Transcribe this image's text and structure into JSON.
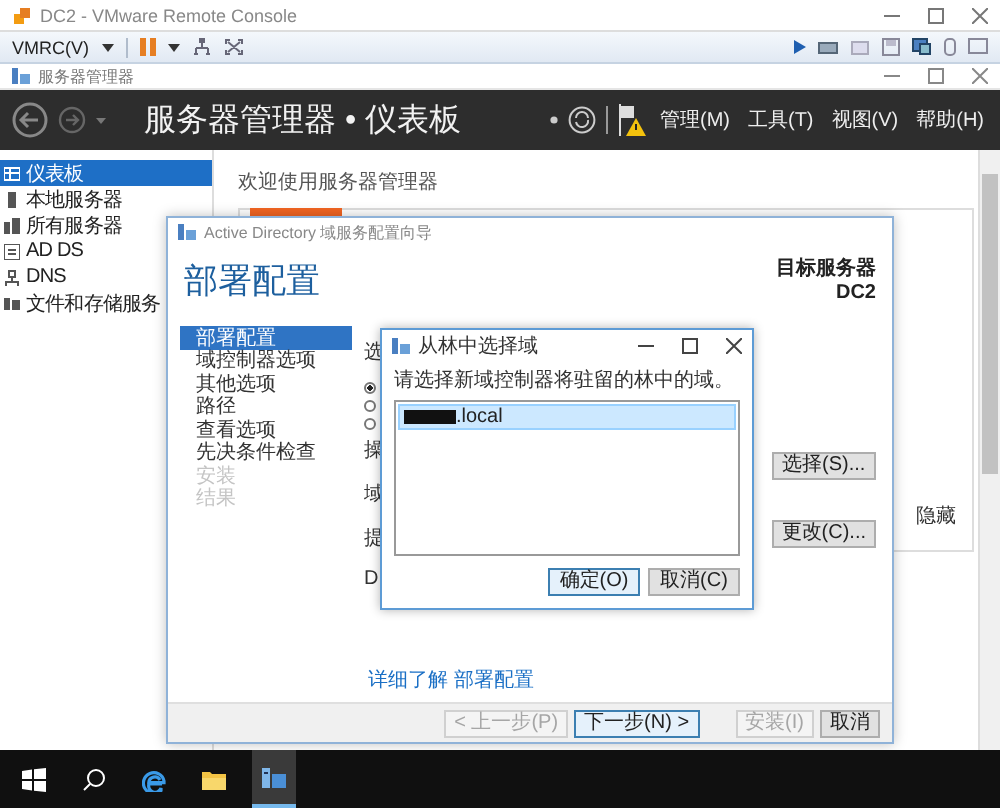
{
  "vmrc": {
    "title": "DC2 - VMware Remote Console",
    "menu": "VMRC(V)"
  },
  "app_window": {
    "title": "服务器管理器"
  },
  "header": {
    "title": "服务器管理器 • 仪表板",
    "menus": [
      "管理(M)",
      "工具(T)",
      "视图(V)",
      "帮助(H)"
    ]
  },
  "sidebar": {
    "items": [
      {
        "label": "仪表板",
        "kind": "dashboard",
        "selected": true
      },
      {
        "label": "本地服务器",
        "kind": "server",
        "selected": false
      },
      {
        "label": "所有服务器",
        "kind": "servers",
        "selected": false
      },
      {
        "label": "AD DS",
        "kind": "directory",
        "selected": false
      },
      {
        "label": "DNS",
        "kind": "network",
        "selected": false
      },
      {
        "label": "文件和存储服务",
        "kind": "storage",
        "selected": false
      }
    ]
  },
  "welcome": {
    "title": "欢迎使用服务器管理器",
    "hide_link": "隐藏"
  },
  "wizard": {
    "title": "Active Directory 域服务配置向导",
    "heading": "部署配置",
    "target_label": "目标服务器",
    "target_server": "DC2",
    "steps": [
      {
        "label": "部署配置",
        "selected": true,
        "disabled": false
      },
      {
        "label": "域控制器选项",
        "selected": false,
        "disabled": false
      },
      {
        "label": "其他选项",
        "selected": false,
        "disabled": false
      },
      {
        "label": "路径",
        "selected": false,
        "disabled": false
      },
      {
        "label": "查看选项",
        "selected": false,
        "disabled": false
      },
      {
        "label": "先决条件检查",
        "selected": false,
        "disabled": false
      },
      {
        "label": "安装",
        "selected": false,
        "disabled": true
      },
      {
        "label": "结果",
        "selected": false,
        "disabled": true
      }
    ],
    "fragments": [
      {
        "kind": "text",
        "text": "选"
      },
      {
        "kind": "radio",
        "selected": true
      },
      {
        "kind": "radio",
        "selected": false
      },
      {
        "kind": "radio",
        "selected": false
      },
      {
        "kind": "text",
        "text": "操"
      },
      {
        "kind": "text",
        "text": "域"
      },
      {
        "kind": "text",
        "text": "提"
      },
      {
        "kind": "text",
        "text": "D"
      }
    ],
    "select_button": "选择(S)...",
    "change_button": "更改(C)...",
    "help_link": "详细了解 部署配置",
    "buttons": [
      {
        "label": "< 上一步(P)",
        "disabled": true,
        "default": false
      },
      {
        "label": "下一步(N) >",
        "disabled": false,
        "default": true
      },
      {
        "label": "安装(I)",
        "disabled": true,
        "default": false
      },
      {
        "label": "取消",
        "disabled": false,
        "default": false
      }
    ]
  },
  "domain_dialog": {
    "title": "从林中选择域",
    "prompt": "请选择新域控制器将驻留的林中的域。",
    "domains": [
      {
        "label": ".local",
        "redacted": true,
        "selected": true
      }
    ],
    "buttons": [
      {
        "label": "确定(O)",
        "default": true
      },
      {
        "label": "取消(C)",
        "default": false
      }
    ]
  },
  "taskbar": {
    "items": [
      {
        "kind": "start",
        "active": false
      },
      {
        "kind": "search",
        "active": false
      },
      {
        "kind": "edge",
        "active": false
      },
      {
        "kind": "explorer",
        "active": false
      },
      {
        "kind": "server-manager",
        "active": true
      }
    ]
  }
}
